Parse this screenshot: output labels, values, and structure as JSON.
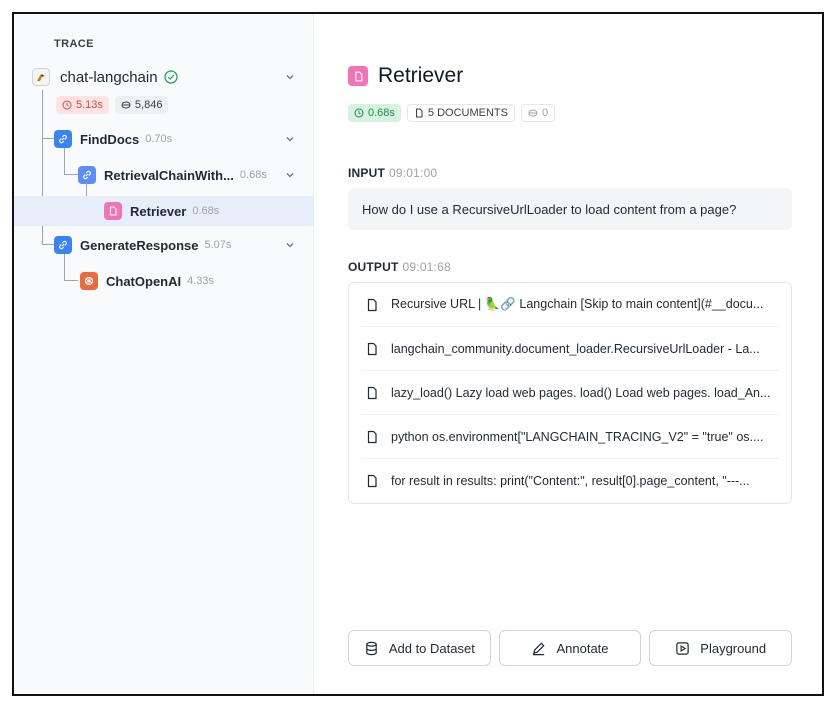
{
  "sidebar": {
    "section_label": "TRACE",
    "root": {
      "name": "chat-langchain",
      "status_icon": "check-circle-icon",
      "latency": "5.13s",
      "tokens": "5,846"
    },
    "nodes": [
      {
        "name": "FindDocs",
        "time": "0.70s",
        "icon": "link-icon",
        "expandable": true
      },
      {
        "name": "RetrievalChainWith...",
        "time": "0.68s",
        "icon": "link-icon",
        "expandable": true
      },
      {
        "name": "Retriever",
        "time": "0.68s",
        "icon": "document-icon",
        "expandable": false,
        "selected": true
      },
      {
        "name": "GenerateResponse",
        "time": "5.07s",
        "icon": "link-icon",
        "expandable": true
      },
      {
        "name": "ChatOpenAI",
        "time": "4.33s",
        "icon": "openai-icon",
        "expandable": false
      }
    ]
  },
  "detail": {
    "title": "Retriever",
    "latency": "0.68s",
    "documents": "5 DOCUMENTS",
    "tokens": "0",
    "input_label": "INPUT",
    "input_time": "09:01:00",
    "input_text": "How do I use a RecursiveUrlLoader to load content from a page?",
    "output_label": "OUTPUT",
    "output_time": "09:01:68",
    "documents_list": [
      "Recursive URL | 🦜🔗 Langchain [Skip to main content](#__docu...",
      "langchain_community.document_loader.RecursiveUrlLoader - La...",
      "lazy_load() Lazy load web pages. load() Load web pages. load_An...",
      "python os.environment[\"LANGCHAIN_TRACING_V2\" = \"true\" os....",
      "for result in results: print(\"Content:\", result[0].page_content, \"---..."
    ]
  },
  "actions": {
    "add_to_dataset": "Add to Dataset",
    "annotate": "Annotate",
    "playground": "Playground"
  },
  "colors": {
    "selected_row": "#e6eef9",
    "chain_icon": "#3b82f6",
    "retriever_icon": "#f472b6",
    "llm_icon": "#ea6b3d",
    "latency_error_chip": "#fde4e2",
    "latency_ok_chip": "#d6f3df"
  }
}
